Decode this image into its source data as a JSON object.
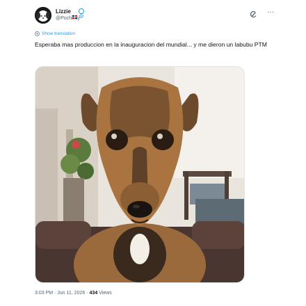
{
  "author": {
    "name": "Lizzie",
    "handle": "@Pochikity",
    "avatar_icon": "pochacco-avatar",
    "flag_icon": "dominican-flag-icon",
    "badge_icon": "globe-verified-icon"
  },
  "actions": {
    "grok_icon": "grok-icon",
    "more_label": "···"
  },
  "translation": {
    "label": "Show translation",
    "icon": "translate-icon"
  },
  "tweet": {
    "text": "Esperaba mas produccion en la inauguracion del mundial... y me dieron un labubu PTM"
  },
  "media": {
    "type": "photo",
    "icon": "dog-photo"
  },
  "meta": {
    "timestamp": "3:03 PM · Jun 11, 2026 ·",
    "views_count": "434",
    "views_label": "Views"
  },
  "colors": {
    "accent": "#1d9bf0",
    "text": "#0f1419",
    "muted": "#536471"
  }
}
